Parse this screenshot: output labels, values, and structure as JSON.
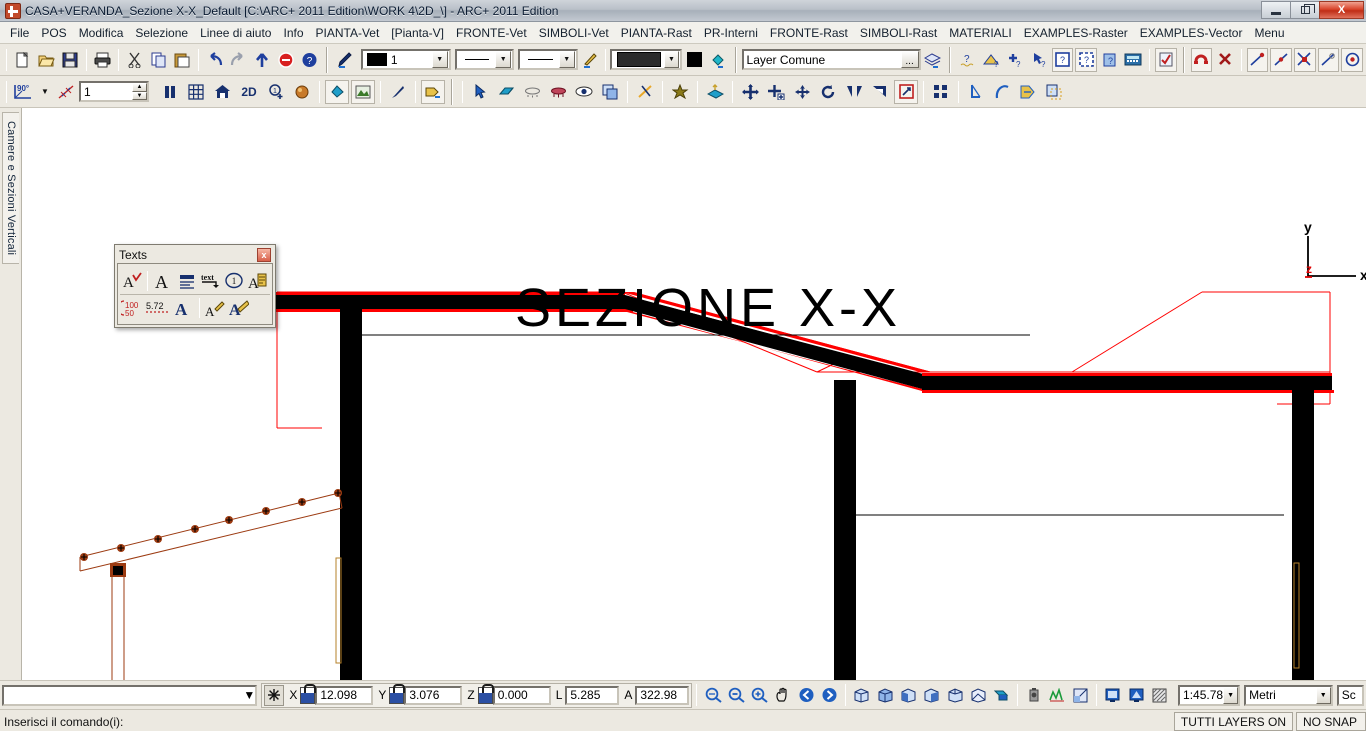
{
  "window": {
    "title": "CASA+VERANDA_Sezione X-X_Default [C:\\ARC+ 2011 Edition\\WORK 4\\2D_\\] - ARC+ 2011 Edition",
    "app_icon": "arcplus-logo-icon",
    "controls": {
      "minimize": "minimize-icon",
      "restore": "restore-icon",
      "close": "X"
    }
  },
  "menubar": {
    "items": [
      {
        "label": "File"
      },
      {
        "label": "POS"
      },
      {
        "label": "Modifica"
      },
      {
        "label": "Selezione"
      },
      {
        "label": "Linee di aiuto"
      },
      {
        "label": "Info"
      },
      {
        "label": "PIANTA-Vet"
      },
      {
        "label": "[Pianta-V]"
      },
      {
        "label": "FRONTE-Vet"
      },
      {
        "label": "SIMBOLI-Vet"
      },
      {
        "label": "PIANTA-Rast"
      },
      {
        "label": "PR-Interni"
      },
      {
        "label": "FRONTE-Rast"
      },
      {
        "label": "SIMBOLI-Rast"
      },
      {
        "label": "MATERIALI"
      },
      {
        "label": "EXAMPLES-Raster"
      },
      {
        "label": "EXAMPLES-Vector"
      },
      {
        "label": "Menu"
      }
    ]
  },
  "toolbar_main": {
    "file_group": [
      {
        "name": "new-file-icon",
        "glyph": "🗋"
      },
      {
        "name": "open-folder-icon",
        "glyph": "📂"
      },
      {
        "name": "save-disk-icon",
        "glyph": "💾"
      }
    ],
    "print_group": [
      {
        "name": "print-icon",
        "glyph": "🖨"
      }
    ],
    "clipboard_group": [
      {
        "name": "cut-scissors-icon",
        "glyph": "✂"
      },
      {
        "name": "copy-icon",
        "glyph": "⧉"
      },
      {
        "name": "paste-icon",
        "glyph": "📋"
      }
    ],
    "history_group": [
      {
        "name": "undo-icon",
        "glyph": "↶"
      },
      {
        "name": "redo-icon",
        "glyph": "↷"
      },
      {
        "name": "up-level-icon",
        "glyph": "↑"
      },
      {
        "name": "stop-icon",
        "glyph": "⛔"
      },
      {
        "name": "help-icon",
        "glyph": "?"
      }
    ],
    "pen_group": [
      {
        "name": "pen-pick-icon",
        "glyph": "✎"
      }
    ],
    "pen_combo": {
      "name": "pen-number-combo",
      "value": "1",
      "swatch": "#000000"
    },
    "linetype_combo": {
      "name": "linetype-combo",
      "value": ""
    },
    "linewidth_combo": {
      "name": "linewidth-combo",
      "value": ""
    },
    "attr_pick": {
      "name": "attribute-picker-icon",
      "glyph": "✎"
    },
    "fill_combo": {
      "name": "fill-pattern-combo",
      "value": "",
      "swatch": "#2b2b2b"
    },
    "fill_color": {
      "name": "fill-color-swatch",
      "color": "#000000"
    },
    "bucket": {
      "name": "paint-bucket-icon",
      "glyph": "🪣"
    },
    "layer": {
      "name": "layer-name-field",
      "value": "Layer Comune",
      "browse_label": "..."
    },
    "layer_manager": {
      "name": "layer-manager-icon",
      "glyph": "≣"
    },
    "query_group": [
      {
        "name": "measure-query-icon",
        "glyph": "?"
      },
      {
        "name": "area-query-icon",
        "glyph": "?"
      },
      {
        "name": "point-query-icon",
        "glyph": "+"
      },
      {
        "name": "select-query-icon",
        "glyph": "?"
      },
      {
        "name": "element-info-icon",
        "glyph": "?"
      },
      {
        "name": "zone-info-icon",
        "glyph": "?"
      },
      {
        "name": "object-info-icon",
        "glyph": "?"
      },
      {
        "name": "calculator-icon",
        "glyph": "⌨"
      },
      {
        "name": "checklist-icon",
        "glyph": "✓"
      }
    ],
    "snap_group": [
      {
        "name": "snap-magnet-icon",
        "glyph": "∩"
      },
      {
        "name": "snap-off-icon",
        "glyph": "✕"
      },
      {
        "name": "snap-endpoint-icon",
        "glyph": "╱"
      },
      {
        "name": "snap-midpoint-icon",
        "glyph": "╱"
      },
      {
        "name": "snap-intersection-icon",
        "glyph": "✕"
      },
      {
        "name": "snap-perpendicular-icon",
        "glyph": "╱"
      },
      {
        "name": "snap-center-icon",
        "glyph": "◉"
      }
    ]
  },
  "toolbar_second": {
    "angle_combo": {
      "name": "angle-mode-combo",
      "value": "90"
    },
    "cross_icon": {
      "name": "construction-line-icon",
      "glyph": "✕"
    },
    "level_spin": {
      "name": "level-spinner",
      "value": "1"
    },
    "view_group": [
      {
        "name": "pause-icon",
        "glyph": "❚❚"
      },
      {
        "name": "grid-icon",
        "glyph": "▦"
      },
      {
        "name": "home-view-icon",
        "glyph": "⌂"
      },
      {
        "name": "two-d-icon",
        "glyph": "2D"
      },
      {
        "name": "add-info-icon",
        "glyph": "①"
      },
      {
        "name": "render-icon",
        "glyph": "◔"
      }
    ],
    "render_group": [
      {
        "name": "paint-fill-icon",
        "glyph": "🪣"
      },
      {
        "name": "landscape-icon",
        "glyph": "⛰"
      },
      {
        "name": "brush-icon",
        "glyph": "✎"
      },
      {
        "name": "tag-icon",
        "glyph": "🏷"
      }
    ],
    "edit_group": [
      {
        "name": "select-arrow-icon",
        "glyph": "↖"
      },
      {
        "name": "eraser-icon",
        "glyph": "▱"
      },
      {
        "name": "hide-icon",
        "glyph": "⌭"
      },
      {
        "name": "visibility-icon",
        "glyph": "◑"
      },
      {
        "name": "eye-icon",
        "glyph": "👁"
      },
      {
        "name": "duplicate-icon",
        "glyph": "⧉"
      }
    ],
    "tools_group": [
      {
        "name": "trim-icon",
        "glyph": "✂"
      },
      {
        "name": "explode-icon",
        "glyph": "✽"
      },
      {
        "name": "extrude-icon",
        "glyph": "▱"
      }
    ],
    "transform_group": [
      {
        "name": "move-icon",
        "glyph": "✥"
      },
      {
        "name": "copy-move-icon",
        "glyph": "✥"
      },
      {
        "name": "scale-icon",
        "glyph": "✣"
      },
      {
        "name": "rotate-icon",
        "glyph": "↻"
      },
      {
        "name": "mirror-icon",
        "glyph": "◢"
      },
      {
        "name": "align-icon",
        "glyph": "◥"
      },
      {
        "name": "stretch-icon",
        "glyph": "⤡"
      }
    ],
    "array_group": [
      {
        "name": "array-icon",
        "glyph": "☷"
      }
    ],
    "draw_group": [
      {
        "name": "line-icon",
        "glyph": "╱"
      },
      {
        "name": "arc-icon",
        "glyph": "◜"
      },
      {
        "name": "polyline-icon",
        "glyph": "⋙"
      },
      {
        "name": "block-icon",
        "glyph": "◰"
      }
    ]
  },
  "left_rail": {
    "tab_label": "Camere e Sezioni Verticali"
  },
  "texts_palette": {
    "title": "Texts",
    "close_label": "x",
    "row1": [
      {
        "name": "spellcheck-icon",
        "glyph": "A"
      },
      {
        "name": "text-font-icon",
        "glyph": "A"
      },
      {
        "name": "paragraph-align-icon",
        "glyph": "≡"
      },
      {
        "name": "text-leader-icon",
        "glyph": "text"
      },
      {
        "name": "circled-number-icon",
        "glyph": "①"
      },
      {
        "name": "text-label-icon",
        "glyph": "A"
      }
    ],
    "row2": [
      {
        "name": "dimension-text-icon",
        "glyph": "100"
      },
      {
        "name": "decimal-text-icon",
        "glyph": "5.72"
      },
      {
        "name": "bold-text-icon",
        "glyph": "A"
      },
      {
        "name": "text-style-pick-icon",
        "glyph": "A"
      },
      {
        "name": "text-edit-icon",
        "glyph": "A"
      }
    ]
  },
  "drawing": {
    "title_text": "SEZIONE  X-X",
    "axis": {
      "x_label": "x",
      "y_label": "y",
      "z_label": "z",
      "z_color": "#e00000"
    },
    "colors": {
      "structure_black": "#000000",
      "outline_red": "#ff0000",
      "pergola_brown": "#9c3b12",
      "ground_gray": "#808080",
      "window_gold": "#b5812a"
    }
  },
  "coordbar": {
    "command_combo": {
      "name": "command-history-combo",
      "value": "",
      "placeholder": ""
    },
    "snap_toggle": {
      "name": "snap-toggle-icon",
      "glyph": "✳"
    },
    "fields": [
      {
        "label": "X",
        "value": "12.098",
        "name": "coord-x-field",
        "locked": false
      },
      {
        "label": "Y",
        "value": "3.076",
        "name": "coord-y-field",
        "locked": false
      },
      {
        "label": "Z",
        "value": "0.000",
        "name": "coord-z-field",
        "locked": true
      },
      {
        "label": "L",
        "value": "5.285",
        "name": "length-field",
        "locked": false
      },
      {
        "label": "A",
        "value": "322.98",
        "name": "angle-field",
        "locked": false
      }
    ],
    "zoom_group": [
      {
        "name": "zoom-window-icon",
        "glyph": "🔍"
      },
      {
        "name": "zoom-out-icon",
        "glyph": "🔍"
      },
      {
        "name": "zoom-in-icon",
        "glyph": "🔍"
      },
      {
        "name": "pan-hand-icon",
        "glyph": "✋"
      },
      {
        "name": "zoom-previous-icon",
        "glyph": "←"
      },
      {
        "name": "zoom-next-icon",
        "glyph": "→"
      }
    ],
    "view3d_group": [
      {
        "name": "view-front-icon",
        "glyph": "□"
      },
      {
        "name": "view-top-icon",
        "glyph": "□"
      },
      {
        "name": "view-left-icon",
        "glyph": "□"
      },
      {
        "name": "view-right-icon",
        "glyph": "□"
      },
      {
        "name": "view-axono-icon",
        "glyph": "□"
      },
      {
        "name": "view-perspective-icon",
        "glyph": "□"
      },
      {
        "name": "view-render-icon",
        "glyph": "◣"
      }
    ],
    "display_group": [
      {
        "name": "camera-icon",
        "glyph": "📷"
      },
      {
        "name": "graph-icon",
        "glyph": "∴"
      },
      {
        "name": "section-icon",
        "glyph": "◧"
      }
    ],
    "mode_group": [
      {
        "name": "monitor-icon",
        "glyph": "▣"
      },
      {
        "name": "shade-icon",
        "glyph": "◐"
      },
      {
        "name": "hatch-icon",
        "glyph": "▨"
      }
    ],
    "scale": {
      "name": "drawing-scale-combo",
      "value": "1:45.78"
    },
    "unit": {
      "name": "unit-combo",
      "value": "Metri"
    },
    "scale_extra": {
      "name": "scale-extra-field",
      "value": "Sc"
    }
  },
  "statusbar": {
    "prompt": "Inserisci il comando(i):",
    "layers_state": "TUTTI LAYERS ON",
    "snap_state": "NO SNAP"
  }
}
